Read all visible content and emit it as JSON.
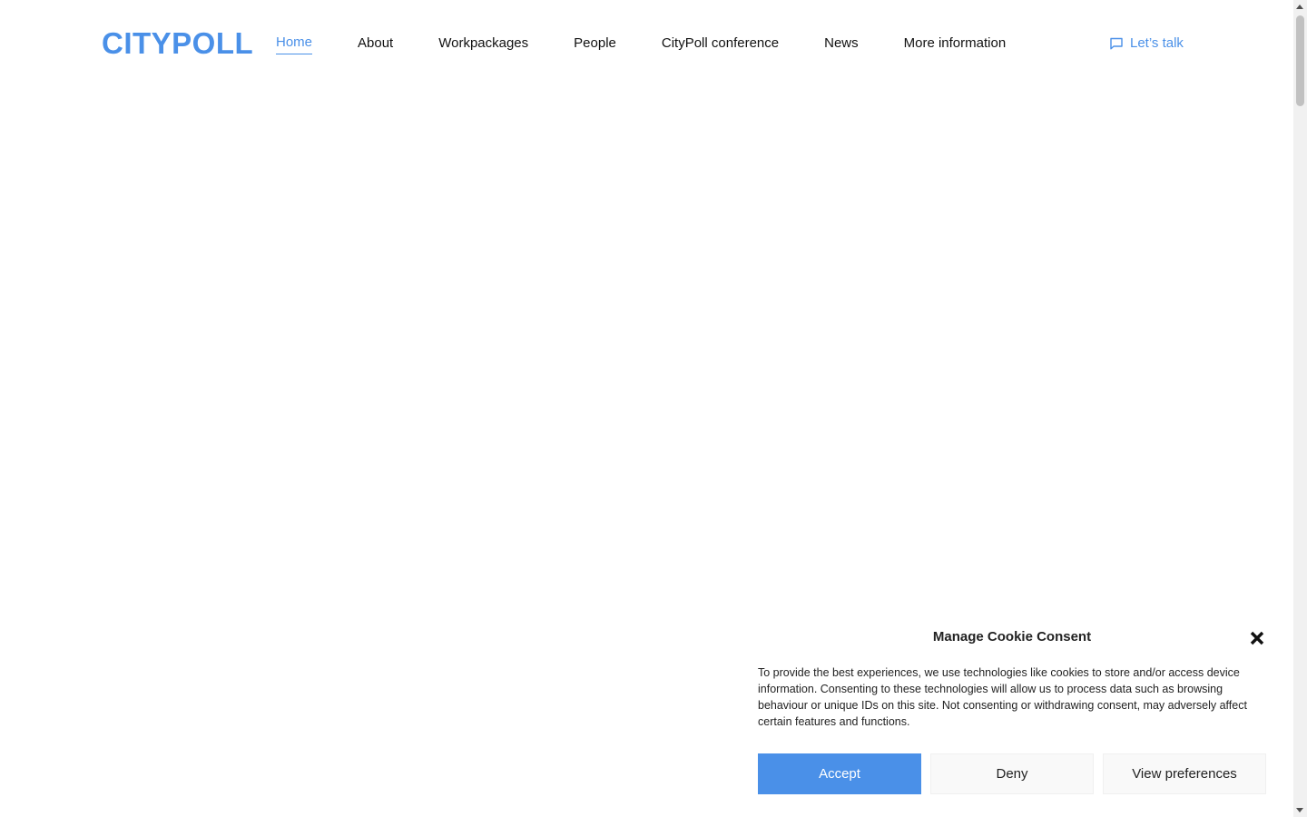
{
  "header": {
    "logo_text": "CITYPOLL",
    "nav": [
      {
        "label": "Home",
        "active": true
      },
      {
        "label": "About",
        "active": false
      },
      {
        "label": "Workpackages",
        "active": false
      },
      {
        "label": "People",
        "active": false
      },
      {
        "label": "CityPoll conference",
        "active": false
      },
      {
        "label": "News",
        "active": false
      },
      {
        "label": "More information",
        "active": false
      }
    ],
    "cta_label": "Let’s talk",
    "cta_icon": "chat-bubble-icon"
  },
  "cookie": {
    "title": "Manage Cookie Consent",
    "close_icon": "close-icon",
    "body": "To provide the best experiences, we use technologies like cookies to store and/or access device information. Consenting to these technologies will allow us to process data such as browsing behaviour or unique IDs on this site. Not consenting or withdrawing consent, may adversely affect certain features and functions.",
    "accept_label": "Accept",
    "deny_label": "Deny",
    "preferences_label": "View preferences"
  },
  "colors": {
    "accent": "#4a90e8",
    "text": "#111111",
    "button_bg": "#f9f9f9"
  }
}
